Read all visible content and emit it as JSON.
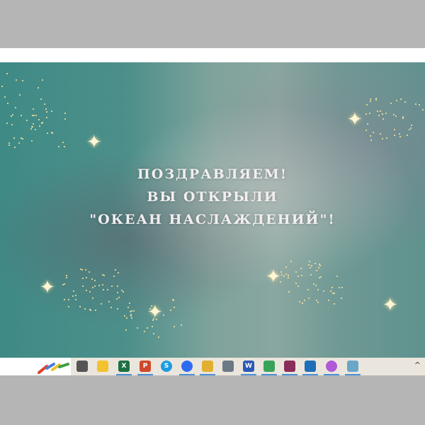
{
  "slide": {
    "lines": [
      "ПОЗДРАВЛЯЕМ!",
      "ВЫ ОТКРЫЛИ",
      "\"ОКЕАН НАСЛАЖДЕНИЙ\"!"
    ]
  },
  "taskbar": {
    "apps": [
      {
        "name": "task-view",
        "color": "#555",
        "label": ""
      },
      {
        "name": "file-explorer",
        "color": "#f2c230",
        "label": ""
      },
      {
        "name": "excel",
        "color": "#1d7044",
        "label": "X"
      },
      {
        "name": "powerpoint",
        "color": "#d0482a",
        "label": "P"
      },
      {
        "name": "skype",
        "color": "#1e9be0",
        "label": "S"
      },
      {
        "name": "zoom",
        "color": "#2d6cf0",
        "label": ""
      },
      {
        "name": "chrome-profile",
        "color": "#e0b030",
        "label": ""
      },
      {
        "name": "calculator",
        "color": "#6c7a86",
        "label": ""
      },
      {
        "name": "word",
        "color": "#2b5bb7",
        "label": "W"
      },
      {
        "name": "chrome",
        "color": "#3aa35a",
        "label": ""
      },
      {
        "name": "winrar",
        "color": "#8b2d5a",
        "label": ""
      },
      {
        "name": "photos",
        "color": "#1f6fb8",
        "label": ""
      },
      {
        "name": "firefox",
        "color": "#b05ad8",
        "label": ""
      },
      {
        "name": "active-app",
        "color": "#6aa6c8",
        "label": ""
      }
    ]
  }
}
